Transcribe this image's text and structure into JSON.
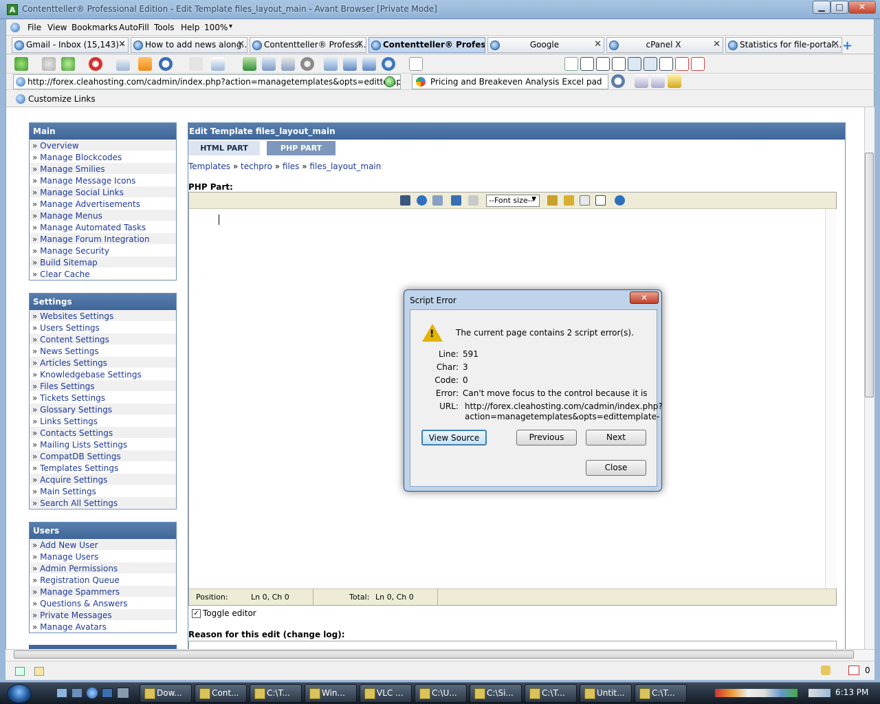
{
  "window": {
    "title": "Contentteller® Professional Edition - Edit Template files_layout_main - Avant Browser [Private Mode]",
    "logo": "A",
    "min": "▁",
    "max": "□",
    "close": "✕"
  },
  "menu": {
    "items": [
      "File",
      "View",
      "Bookmarks",
      "AutoFill",
      "Tools",
      "Help",
      "100%"
    ],
    "zoom_arrow": "▾"
  },
  "tabs": [
    {
      "label": "Gmail - Inbox (15,143) - ..."
    },
    {
      "label": "How to add news along..."
    },
    {
      "label": "Contentteller® Professi..."
    },
    {
      "label": "Contentteller® Profes..."
    },
    {
      "label": "Google"
    },
    {
      "label": "cPanel X"
    },
    {
      "label": "Statistics for file-portal...."
    }
  ],
  "tab_close": "✕",
  "tab_new": "+",
  "address": {
    "url": "http://forex.cleahosting.com/cadmin/index.php?action=managetemplates&opts=edittempla",
    "search": "Pricing and Breakeven Analysis Excel pad"
  },
  "links": {
    "label": "Customize Links"
  },
  "sidebar": {
    "main": {
      "title": "Main",
      "items": [
        "Overview",
        "Manage Blockcodes",
        "Manage Smilies",
        "Manage Message Icons",
        "Manage Social Links",
        "Manage Advertisements",
        "Manage Menus",
        "Manage Automated Tasks",
        "Manage Forum Integration",
        "Manage Security",
        "Build Sitemap",
        "Clear Cache"
      ]
    },
    "settings": {
      "title": "Settings",
      "items": [
        "Websites Settings",
        "Users Settings",
        "Content Settings",
        "News Settings",
        "Articles Settings",
        "Knowledgebase Settings",
        "Files Settings",
        "Tickets Settings",
        "Glossary Settings",
        "Links Settings",
        "Contacts Settings",
        "Mailing Lists Settings",
        "CompatDB Settings",
        "Templates Settings",
        "Acquire Settings",
        "Main Settings",
        "Search All Settings"
      ]
    },
    "users": {
      "title": "Users",
      "items": [
        "Add New User",
        "Manage Users",
        "Admin Permissions",
        "Registration Queue",
        "Manage Spammers",
        "Questions & Answers",
        "Private Messages",
        "Manage Avatars"
      ]
    }
  },
  "edit": {
    "title": "Edit Template files_layout_main",
    "tab_html": "HTML PART",
    "tab_php": "PHP PART",
    "breadcrumb": [
      "Templates",
      "techpro",
      "files",
      "files_layout_main"
    ],
    "crumb_sep": " » ",
    "php_label": "PHP Part:",
    "font_size": "--Font size--",
    "status": {
      "position_label": "Position:",
      "position_value": "Ln 0, Ch 0",
      "total_label": "Total:",
      "total_value": "Ln 0, Ch 0"
    },
    "toggle_label": "Toggle editor",
    "toggle_check": "✓",
    "reason_label": "Reason for this edit (change log):"
  },
  "dialog": {
    "title": "Script Error",
    "close": "✕",
    "message": "The current page contains 2 script error(s).",
    "warn_mark": "!",
    "fields": [
      {
        "label": "Line:",
        "value": "591"
      },
      {
        "label": "Char:",
        "value": "3"
      },
      {
        "label": "Code:",
        "value": "0"
      },
      {
        "label": "Error:",
        "value": "Can't move focus to the control because it is"
      },
      {
        "label": "URL:",
        "value": "http://forex.cleahosting.com/cadmin/index.php?"
      }
    ],
    "url_line2": "action=managetemplates&opts=edittemplate-",
    "btn_view_source": "View Source",
    "btn_previous": "Previous",
    "btn_next": "Next",
    "btn_close": "Close"
  },
  "taskbar": {
    "buttons": [
      "Dow...",
      "Cont...",
      "C:\\T...",
      "Win...",
      "VLC ...",
      "C:\\U...",
      "C:\\Si...",
      "C:\\T...",
      "Untit...",
      "C:\\T..."
    ],
    "clock": "6:13 PM"
  },
  "status_right": "0"
}
